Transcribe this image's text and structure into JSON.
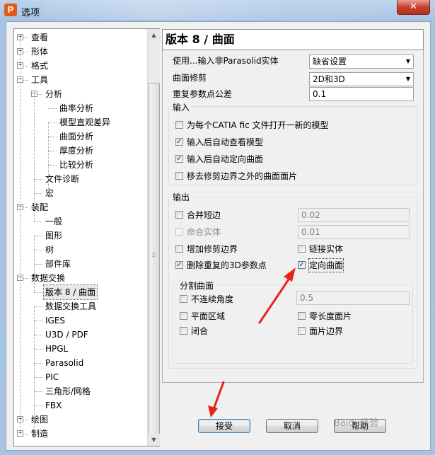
{
  "window": {
    "title": "选项",
    "app_icon_letter": "P",
    "close_glyph": "✕"
  },
  "tree": {
    "items": [
      {
        "label": "查看",
        "level": 0,
        "expander": "+"
      },
      {
        "label": "形体",
        "level": 0,
        "expander": "+"
      },
      {
        "label": "格式",
        "level": 0,
        "expander": "+"
      },
      {
        "label": "工具",
        "level": 0,
        "expander": "−"
      },
      {
        "label": "分析",
        "level": 1,
        "expander": "−"
      },
      {
        "label": "曲率分析",
        "level": 2
      },
      {
        "label": "模型直观差异",
        "level": 2
      },
      {
        "label": "曲面分析",
        "level": 2
      },
      {
        "label": "厚度分析",
        "level": 2
      },
      {
        "label": "比较分析",
        "level": 2
      },
      {
        "label": "文件诊断",
        "level": 1
      },
      {
        "label": "宏",
        "level": 1
      },
      {
        "label": "装配",
        "level": 0,
        "expander": "−"
      },
      {
        "label": "一般",
        "level": 1
      },
      {
        "label": "图形",
        "level": 1
      },
      {
        "label": "树",
        "level": 1
      },
      {
        "label": "部件库",
        "level": 1
      },
      {
        "label": "数据交换",
        "level": 0,
        "expander": "−"
      },
      {
        "label": "版本 8 / 曲面",
        "level": 1,
        "selected": true
      },
      {
        "label": "数据交换工具",
        "level": 1
      },
      {
        "label": "IGES",
        "level": 1
      },
      {
        "label": "U3D / PDF",
        "level": 1
      },
      {
        "label": "HPGL",
        "level": 1
      },
      {
        "label": "Parasolid",
        "level": 1
      },
      {
        "label": "PIC",
        "level": 1
      },
      {
        "label": "三角形/网格",
        "level": 1
      },
      {
        "label": "FBX",
        "level": 1
      },
      {
        "label": "绘图",
        "level": 0,
        "expander": "+"
      },
      {
        "label": "制造",
        "level": 0,
        "expander": "+"
      }
    ]
  },
  "pane": {
    "title": "版本 8 / 曲面",
    "import_non_parasolid": {
      "label": "使用...输入非Parasolid实体",
      "value": "缺省设置"
    },
    "surface_trim": {
      "label": "曲面修剪",
      "value": "2D和3D"
    },
    "duplicate_tolerance": {
      "label": "重复参数点公差",
      "value": "0.1"
    },
    "input_group": {
      "title": "输入",
      "options": [
        {
          "label": "为每个CATIA fic 文件打开一新的模型",
          "checked": false
        },
        {
          "label": "输入后自动查看模型",
          "checked": true
        },
        {
          "label": "输入后自动定向曲面",
          "checked": true
        },
        {
          "label": "移去修剪边界之外的曲面面片",
          "checked": false
        }
      ]
    },
    "output_group": {
      "title": "输出",
      "merge_short_edges": {
        "label": "合并短边",
        "checked": false,
        "value": "0.02"
      },
      "name_solid": {
        "label": "命合实体",
        "checked": false,
        "value": "0.01"
      },
      "add_trim_boundary": {
        "label": "增加修剪边界",
        "checked": false
      },
      "link_solid": {
        "label": "链接实体",
        "checked": false
      },
      "delete_duplicate_points": {
        "label": "删除重复的3D参数点",
        "checked": true
      },
      "orient_surface": {
        "label": "定向曲面",
        "checked": true
      }
    },
    "split_group": {
      "title": "分割曲面",
      "discontinuous_angle": {
        "label": "不连续角度",
        "checked": false,
        "value": "0.5"
      },
      "planar_region": {
        "label": "平面区域",
        "checked": false
      },
      "zero_length_patch": {
        "label": "零长度面片",
        "checked": false
      },
      "closed": {
        "label": "闭合",
        "checked": false
      },
      "patch_boundary": {
        "label": "面片边界",
        "checked": false
      }
    }
  },
  "buttons": {
    "accept": "接受",
    "cancel": "取消",
    "help": "帮助"
  },
  "watermark_text": "Baidu经验",
  "check_glyph": "✓",
  "dropdown_glyph": "▼",
  "colors": {
    "annotation_arrow": "#e8231a",
    "title_bar": "#bcd3ec"
  }
}
